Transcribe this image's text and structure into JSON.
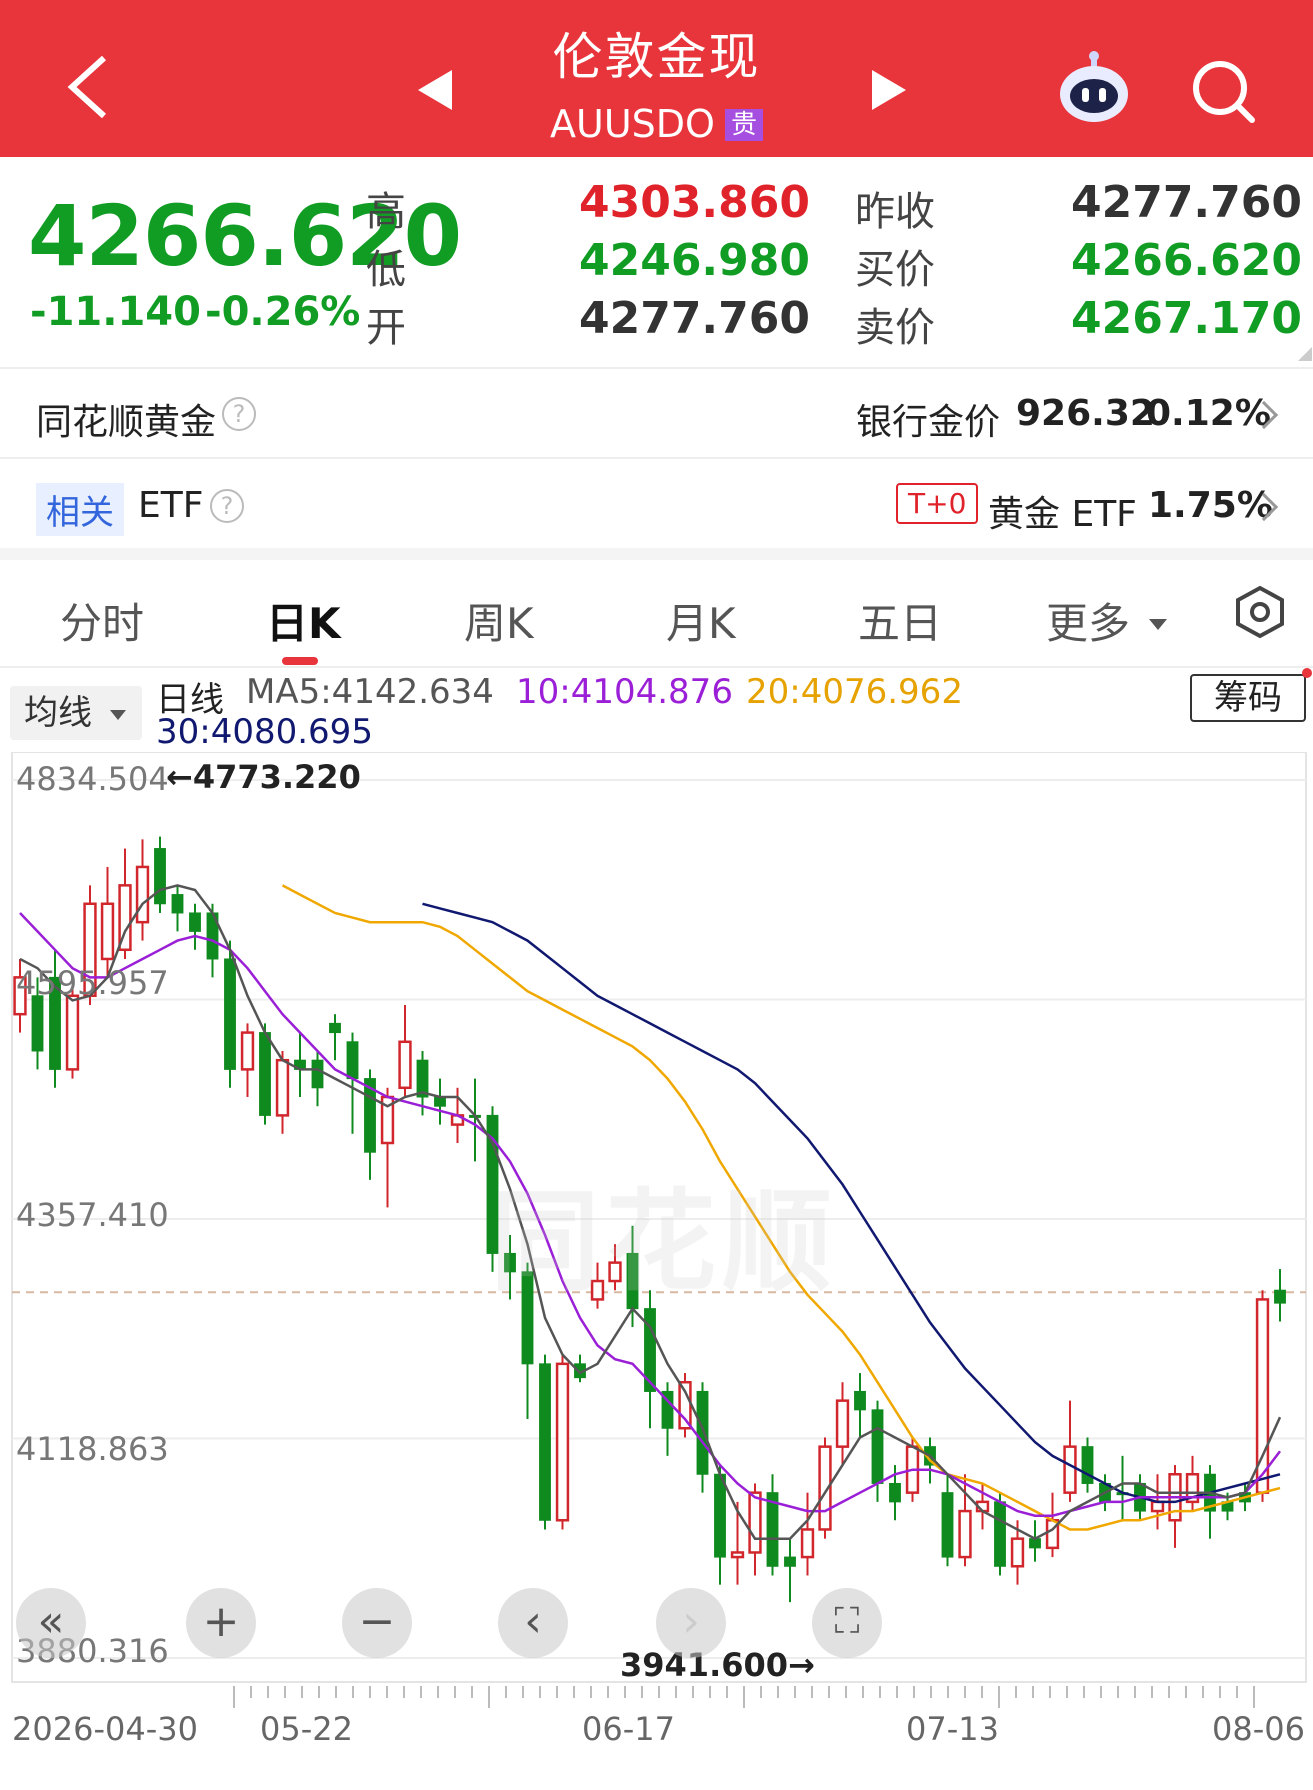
{
  "header": {
    "title": "伦敦金现",
    "subtitle": "AUUSDO",
    "tag": "贵",
    "colors": {
      "bar": "#e8343b",
      "tag": "#a64ee0"
    },
    "icons": [
      "back-arrow-icon",
      "prev-triangle-icon",
      "next-triangle-icon",
      "robot-assistant-icon",
      "search-icon"
    ]
  },
  "quote": {
    "price": "4266.620",
    "change": "-11.140",
    "change_pct": "-0.26%",
    "labels": {
      "high": "高",
      "low": "低",
      "open": "开",
      "prev_close": "昨收",
      "bid": "买价",
      "ask": "卖价"
    },
    "high": "4303.860",
    "low": "4246.980",
    "open": "4277.760",
    "prev_close": "4277.760",
    "bid": "4266.620",
    "ask": "4267.170"
  },
  "ths_gold": {
    "label": "同花顺黄金",
    "bank_label": "银行金价",
    "bank_price": "926.32",
    "bank_pct": "0.12%"
  },
  "etf": {
    "related": "相关",
    "label": "ETF",
    "t0": "T+0",
    "gold_etf": "黄金 ETF",
    "gold_etf_pct": "1.75%"
  },
  "tabs": [
    {
      "label": "分时",
      "active": false
    },
    {
      "label": "日K",
      "active": true
    },
    {
      "label": "周K",
      "active": false
    },
    {
      "label": "月K",
      "active": false
    },
    {
      "label": "五日",
      "active": false
    },
    {
      "label": "更多",
      "active": false
    }
  ],
  "legend": {
    "ma_button": "均线",
    "line_type": "日线",
    "ma5": "MA5:4142.634",
    "ma10": "10:4104.876",
    "ma20": "20:4076.962",
    "ma30": "30:4080.695",
    "chip_button": "筹码",
    "colors": {
      "ma5": "#555555",
      "ma10": "#9a1fd6",
      "ma20": "#f0a800",
      "ma30": "#101870"
    }
  },
  "chart_data": {
    "type": "candlestick",
    "y_ticks": [
      "4834.504",
      "4595.957",
      "4357.410",
      "4118.863",
      "3880.316"
    ],
    "x_ticks": [
      "2026-04-30",
      "05-22",
      "06-17",
      "07-13",
      "08-06"
    ],
    "ylim": [
      3880.316,
      4834.504
    ],
    "max_annotation": "←4773.220",
    "min_annotation": "3941.600→",
    "reference_price": 4277.76,
    "watermark": "同花顺",
    "up_color": "#d0262c",
    "down_color": "#0f8a1e",
    "candles": [
      [
        4620,
        4580,
        4640,
        4560,
        1
      ],
      [
        4600,
        4540,
        4620,
        4520,
        0
      ],
      [
        4620,
        4520,
        4650,
        4500,
        0
      ],
      [
        4520,
        4600,
        4610,
        4510,
        1
      ],
      [
        4600,
        4700,
        4720,
        4590,
        1
      ],
      [
        4640,
        4700,
        4740,
        4620,
        1
      ],
      [
        4650,
        4720,
        4760,
        4640,
        1
      ],
      [
        4680,
        4740,
        4770,
        4660,
        1
      ],
      [
        4760,
        4700,
        4773,
        4690,
        0
      ],
      [
        4710,
        4690,
        4720,
        4670,
        0
      ],
      [
        4690,
        4670,
        4700,
        4650,
        0
      ],
      [
        4690,
        4640,
        4700,
        4620,
        0
      ],
      [
        4640,
        4520,
        4660,
        4500,
        0
      ],
      [
        4520,
        4560,
        4570,
        4490,
        1
      ],
      [
        4560,
        4470,
        4570,
        4460,
        0
      ],
      [
        4470,
        4530,
        4540,
        4450,
        1
      ],
      [
        4530,
        4520,
        4560,
        4490,
        0
      ],
      [
        4530,
        4500,
        4540,
        4480,
        0
      ],
      [
        4570,
        4560,
        4580,
        4530,
        0
      ],
      [
        4550,
        4510,
        4560,
        4450,
        0
      ],
      [
        4510,
        4430,
        4520,
        4400,
        0
      ],
      [
        4440,
        4490,
        4500,
        4370,
        1
      ],
      [
        4500,
        4550,
        4590,
        4490,
        1
      ],
      [
        4530,
        4490,
        4540,
        4470,
        0
      ],
      [
        4490,
        4480,
        4510,
        4460,
        0
      ],
      [
        4460,
        4470,
        4500,
        4440,
        1
      ],
      [
        4470,
        4470,
        4510,
        4420,
        0
      ],
      [
        4470,
        4320,
        4480,
        4300,
        0
      ],
      [
        4320,
        4300,
        4340,
        4270,
        0
      ],
      [
        4300,
        4200,
        4310,
        4140,
        0
      ],
      [
        4200,
        4030,
        4210,
        4020,
        0
      ],
      [
        4030,
        4200,
        4210,
        4020,
        1
      ],
      [
        4200,
        4185,
        4210,
        4180,
        0
      ],
      [
        4270,
        4290,
        4310,
        4260,
        1
      ],
      [
        4290,
        4310,
        4330,
        4280,
        1
      ],
      [
        4320,
        4260,
        4350,
        4240,
        0
      ],
      [
        4260,
        4170,
        4280,
        4130,
        0
      ],
      [
        4170,
        4130,
        4180,
        4100,
        0
      ],
      [
        4130,
        4180,
        4190,
        4120,
        1
      ],
      [
        4170,
        4080,
        4180,
        4060,
        0
      ],
      [
        4080,
        3990,
        4090,
        3960,
        0
      ],
      [
        3990,
        3995,
        4050,
        3960,
        1
      ],
      [
        3995,
        4060,
        4070,
        3970,
        1
      ],
      [
        4060,
        3980,
        4080,
        3970,
        0
      ],
      [
        3980,
        3990,
        4010,
        3941,
        0
      ],
      [
        3990,
        4020,
        4060,
        3970,
        1
      ],
      [
        4020,
        4110,
        4120,
        4010,
        1
      ],
      [
        4110,
        4160,
        4180,
        4090,
        1
      ],
      [
        4170,
        4150,
        4190,
        4120,
        0
      ],
      [
        4150,
        4070,
        4160,
        4050,
        0
      ],
      [
        4070,
        4050,
        4090,
        4030,
        0
      ],
      [
        4060,
        4110,
        4120,
        4050,
        1
      ],
      [
        4110,
        4090,
        4120,
        4070,
        0
      ],
      [
        4060,
        3990,
        4080,
        3980,
        0
      ],
      [
        3990,
        4040,
        4080,
        3980,
        1
      ],
      [
        4040,
        4050,
        4070,
        4020,
        1
      ],
      [
        4050,
        3980,
        4060,
        3970,
        0
      ],
      [
        3980,
        4010,
        4030,
        3960,
        1
      ],
      [
        4010,
        4000,
        4030,
        3985,
        0
      ],
      [
        4000,
        4030,
        4060,
        3990,
        1
      ],
      [
        4060,
        4110,
        4160,
        4050,
        1
      ],
      [
        4110,
        4070,
        4120,
        4060,
        0
      ],
      [
        4070,
        4050,
        4080,
        4040,
        0
      ],
      [
        4060,
        4060,
        4100,
        4030,
        0
      ],
      [
        4070,
        4040,
        4080,
        4030,
        0
      ],
      [
        4040,
        4050,
        4080,
        4020,
        1
      ],
      [
        4030,
        4080,
        4090,
        4000,
        1
      ],
      [
        4050,
        4080,
        4100,
        4040,
        1
      ],
      [
        4080,
        4040,
        4090,
        4010,
        0
      ],
      [
        4050,
        4040,
        4060,
        4030,
        0
      ],
      [
        4050,
        4060,
        4070,
        4040,
        0
      ],
      [
        4060,
        4270,
        4280,
        4050,
        1
      ],
      [
        4280,
        4266,
        4303,
        4246,
        0
      ]
    ],
    "ma5": [
      4640,
      4630,
      4610,
      4595,
      4600,
      4620,
      4670,
      4700,
      4715,
      4720,
      4715,
      4690,
      4650,
      4600,
      4560,
      4530,
      4520,
      4520,
      4510,
      4500,
      4490,
      4480,
      4490,
      4495,
      4490,
      4490,
      4470,
      4440,
      4390,
      4330,
      4250,
      4210,
      4190,
      4200,
      4230,
      4260,
      4240,
      4200,
      4170,
      4130,
      4080,
      4040,
      4010,
      4010,
      4010,
      4030,
      4060,
      4090,
      4120,
      4130,
      4120,
      4110,
      4100,
      4080,
      4060,
      4040,
      4030,
      4020,
      4010,
      4020,
      4040,
      4050,
      4060,
      4070,
      4070,
      4060,
      4060,
      4060,
      4060,
      4055,
      4060,
      4100,
      4142
    ],
    "ma10": [
      4690,
      4670,
      4650,
      4630,
      4620,
      4620,
      4630,
      4640,
      4650,
      4660,
      4665,
      4660,
      4650,
      4630,
      4605,
      4580,
      4560,
      4540,
      4520,
      4510,
      4500,
      4490,
      4485,
      4480,
      4475,
      4470,
      4460,
      4445,
      4420,
      4385,
      4340,
      4290,
      4250,
      4220,
      4205,
      4200,
      4180,
      4160,
      4140,
      4115,
      4090,
      4070,
      4055,
      4050,
      4045,
      4040,
      4040,
      4050,
      4060,
      4070,
      4080,
      4085,
      4085,
      4080,
      4070,
      4060,
      4050,
      4040,
      4035,
      4035,
      4040,
      4045,
      4050,
      4050,
      4055,
      4055,
      4055,
      4055,
      4055,
      4055,
      4060,
      4080,
      4105
    ],
    "ma20": [
      4720,
      4710,
      4700,
      4690,
      4685,
      4680,
      4680,
      4680,
      4680,
      4675,
      4665,
      4650,
      4635,
      4620,
      4605,
      4595,
      4585,
      4575,
      4565,
      4555,
      4545,
      4530,
      4510,
      4485,
      4455,
      4420,
      4390,
      4360,
      4330,
      4300,
      4275,
      4255,
      4235,
      4210,
      4180,
      4150,
      4120,
      4095,
      4080,
      4075,
      4070,
      4060,
      4050,
      4040,
      4030,
      4020,
      4020,
      4025,
      4030,
      4030,
      4035,
      4040,
      4040,
      4045,
      4050,
      4055,
      4060,
      4065
    ],
    "ma30": [
      4700,
      4695,
      4690,
      4685,
      4680,
      4670,
      4660,
      4645,
      4630,
      4615,
      4600,
      4590,
      4580,
      4570,
      4560,
      4550,
      4540,
      4530,
      4520,
      4505,
      4485,
      4465,
      4445,
      4420,
      4395,
      4365,
      4335,
      4305,
      4275,
      4245,
      4220,
      4195,
      4175,
      4155,
      4135,
      4115,
      4100,
      4090,
      4080,
      4070,
      4060,
      4055,
      4050,
      4050,
      4055,
      4060,
      4065,
      4070,
      4075,
      4080
    ]
  },
  "controls": [
    "rewind-icon",
    "zoom-in-icon",
    "zoom-out-icon",
    "scroll-left-icon",
    "scroll-right-icon",
    "fullscreen-icon"
  ]
}
